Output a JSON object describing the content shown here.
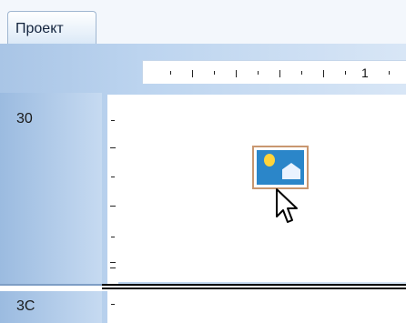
{
  "tab": {
    "label": "Проект"
  },
  "ruler": {
    "number": "1"
  },
  "rows": [
    {
      "label": "30"
    },
    {
      "label": "3C"
    }
  ],
  "colors": {
    "tab_border": "#9fb6d1",
    "panel_blue": "#a9c5e6",
    "icon_blue": "#2b86c9",
    "icon_border": "#c99770",
    "bulb_yellow": "#ffd43b"
  },
  "icons": {
    "shape": "picture-shape-icon",
    "cursor": "arrow-cursor-icon"
  }
}
